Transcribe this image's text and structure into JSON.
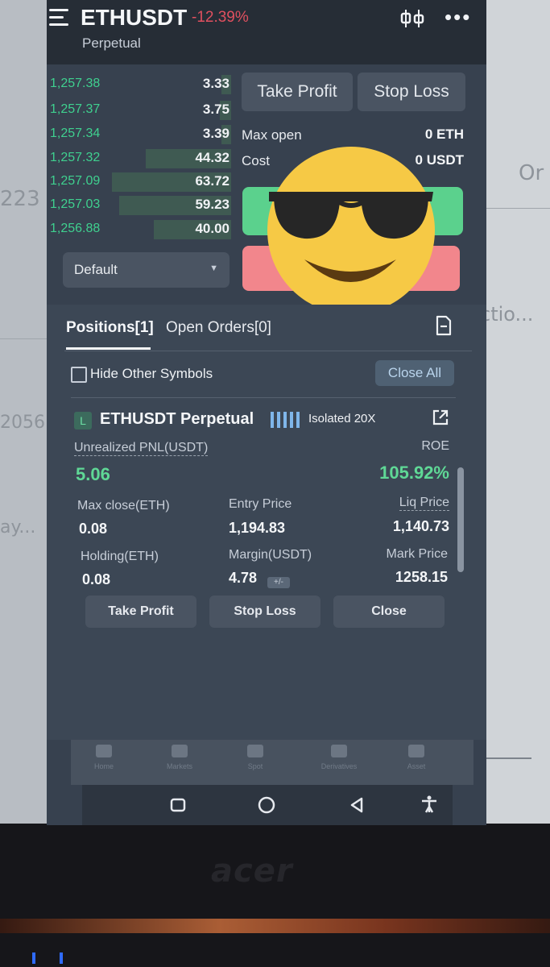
{
  "header": {
    "pair": "ETHUSDT",
    "change": "-12.39%",
    "subtitle": "Perpetual"
  },
  "orderbook": [
    {
      "price": "1,257.38",
      "qty": "3.33",
      "depth": 0.05
    },
    {
      "price": "1,257.37",
      "qty": "3.75",
      "depth": 0.06
    },
    {
      "price": "1,257.34",
      "qty": "3.39",
      "depth": 0.05
    },
    {
      "price": "1,257.32",
      "qty": "44.32",
      "depth": 0.45
    },
    {
      "price": "1,257.09",
      "qty": "63.72",
      "depth": 0.63
    },
    {
      "price": "1,257.03",
      "qty": "59.23",
      "depth": 0.59
    },
    {
      "price": "1,256.88",
      "qty": "40.00",
      "depth": 0.41
    }
  ],
  "order_select": {
    "value": "Default"
  },
  "trade_tabs": {
    "take_profit": "Take Profit",
    "stop_loss": "Stop Loss"
  },
  "trade_info": {
    "max_open_label": "Max open",
    "max_open_value": "0 ETH",
    "cost_label": "Cost",
    "cost_value": "0 USDT"
  },
  "tabs": {
    "positions": "Positions[1]",
    "open_orders": "Open Orders[0]"
  },
  "filter": {
    "hide_label": "Hide Other Symbols",
    "close_all": "Close All"
  },
  "position": {
    "side_badge": "L",
    "title": "ETHUSDT Perpetual",
    "margin_mode": "Isolated 20X",
    "unrealized_pnl_label": "Unrealized PNL(USDT)",
    "unrealized_pnl": "5.06",
    "roe_label": "ROE",
    "roe": "105.92%",
    "max_close_label": "Max close(ETH)",
    "max_close": "0.08",
    "entry_price_label": "Entry Price",
    "entry_price": "1,194.83",
    "liq_price_label": "Liq Price",
    "liq_price": "1,140.73",
    "holding_label": "Holding(ETH)",
    "holding": "0.08",
    "margin_label": "Margin(USDT)",
    "margin": "4.78",
    "margin_chip": "+/-",
    "mark_price_label": "Mark Price",
    "mark_price": "1258.15",
    "take_profit": "Take Profit",
    "stop_loss": "Stop Loss",
    "close": "Close"
  },
  "bottom_nav": [
    {
      "label": "Home"
    },
    {
      "label": "Markets"
    },
    {
      "label": "Spot"
    },
    {
      "label": "Derivatives"
    },
    {
      "label": "Asset"
    }
  ],
  "surroundings": {
    "brand": "acer",
    "ghost_texts": [
      "223",
      "2056",
      "ay...",
      "ctio...",
      "Or"
    ]
  },
  "colors": {
    "up": "#5fd896",
    "down": "#e0505f",
    "buy_button": "#5bd18d",
    "sell_button": "#f2868c"
  }
}
